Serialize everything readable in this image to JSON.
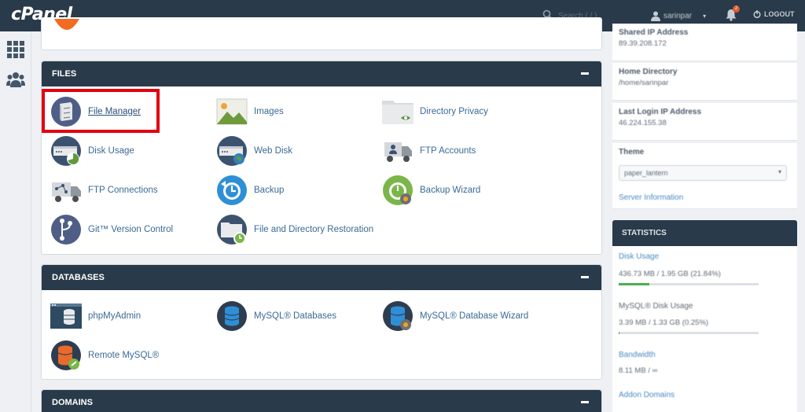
{
  "brand": {
    "logo": "cPanel"
  },
  "header": {
    "search_placeholder": "Search ( / )",
    "username": "sarinpar",
    "logout_label": "LOGOUT",
    "notification_count": "2"
  },
  "sections": {
    "files": {
      "title": "FILES",
      "items": [
        {
          "label": "File Manager",
          "icon": "file-manager-icon"
        },
        {
          "label": "Images",
          "icon": "images-icon"
        },
        {
          "label": "Directory Privacy",
          "icon": "directory-privacy-icon"
        },
        {
          "label": "Disk Usage",
          "icon": "disk-usage-icon"
        },
        {
          "label": "Web Disk",
          "icon": "web-disk-icon"
        },
        {
          "label": "FTP Accounts",
          "icon": "ftp-accounts-icon"
        },
        {
          "label": "FTP Connections",
          "icon": "ftp-connections-icon"
        },
        {
          "label": "Backup",
          "icon": "backup-icon"
        },
        {
          "label": "Backup Wizard",
          "icon": "backup-wizard-icon"
        },
        {
          "label": "Git™ Version Control",
          "icon": "git-icon"
        },
        {
          "label": "File and Directory Restoration",
          "icon": "restore-icon"
        }
      ]
    },
    "databases": {
      "title": "DATABASES",
      "items": [
        {
          "label": "phpMyAdmin",
          "icon": "phpmyadmin-icon"
        },
        {
          "label": "MySQL® Databases",
          "icon": "mysql-databases-icon"
        },
        {
          "label": "MySQL® Database Wizard",
          "icon": "mysql-wizard-icon"
        },
        {
          "label": "Remote MySQL®",
          "icon": "remote-mysql-icon"
        }
      ]
    },
    "domains": {
      "title": "DOMAINS"
    }
  },
  "general_info": {
    "shared_ip_title": "Shared IP Address",
    "shared_ip_value": "89.39.208.172",
    "home_dir_title": "Home Directory",
    "home_dir_value": "/home/sarinpar",
    "last_login_title": "Last Login IP Address",
    "last_login_value": "46.224.155.38",
    "theme_title": "Theme",
    "theme_value": "paper_lantern",
    "server_info_link": "Server Information"
  },
  "statistics": {
    "title": "STATISTICS",
    "disk_usage_title": "Disk Usage",
    "disk_usage_value": "436.73 MB / 1.95 GB  (21.84%)",
    "disk_usage_fraction": 0.2184,
    "mysql_title": "MySQL® Disk Usage",
    "mysql_value": "3.39 MB / 1.33 GB  (0.25%)",
    "mysql_fraction": 0.0025,
    "bandwidth_title": "Bandwidth",
    "bandwidth_value": "8.11 MB / ∞",
    "addon_title": "Addon Domains"
  },
  "colors": {
    "header_bg": "#293a4a",
    "link": "#3b6a95",
    "highlight": "#e3000f",
    "progress": "#4caf50"
  }
}
